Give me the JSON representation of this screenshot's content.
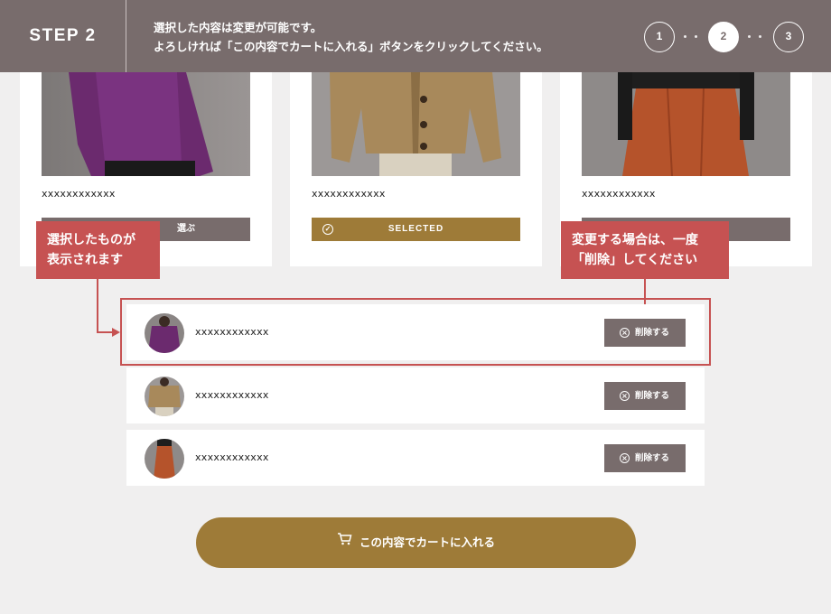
{
  "header": {
    "step_label": "STEP 2",
    "message_line1": "選択した内容は変更が可能です。",
    "message_line2": "よろしければ「この内容でカートに入れる」ボタンをクリックしてください。",
    "steps": [
      "1",
      "2",
      "3"
    ],
    "active_step": "2"
  },
  "products": [
    {
      "name": "xxxxxxxxxxxx",
      "button_label": "選ぶ",
      "state": "choose",
      "image_icon": "purple-sweater-photo"
    },
    {
      "name": "xxxxxxxxxxxx",
      "button_label": "SELECTED",
      "state": "selected",
      "image_icon": "beige-cardigan-photo"
    },
    {
      "name": "xxxxxxxxxxxx",
      "button_label": "",
      "state": "choose",
      "image_icon": "orange-skirt-photo"
    }
  ],
  "callouts": {
    "left_line1": "選択したものが",
    "left_line2": "表示されます",
    "right_line1": "変更する場合は、一度",
    "right_line2": "「削除」してください"
  },
  "selected_items": [
    {
      "name": "xxxxxxxxxxxx",
      "delete_label": "削除する",
      "thumb_icon": "purple-sweater-thumb"
    },
    {
      "name": "xxxxxxxxxxxx",
      "delete_label": "削除する",
      "thumb_icon": "beige-cardigan-thumb"
    },
    {
      "name": "xxxxxxxxxxxx",
      "delete_label": "削除する",
      "thumb_icon": "orange-skirt-thumb"
    }
  ],
  "cart_button": {
    "label": "この内容でカートに入れる",
    "icon": "cart-icon"
  },
  "colors": {
    "header": "#786c6c",
    "accent_gold": "#9e7b38",
    "callout_red": "#c65252",
    "background": "#f0efef"
  }
}
